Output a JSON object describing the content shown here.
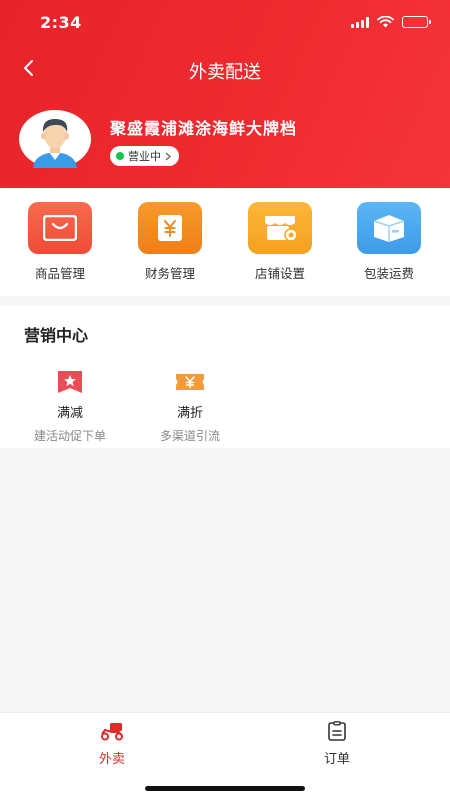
{
  "status_bar": {
    "time": "2:34"
  },
  "nav": {
    "title": "外卖配送",
    "back_icon": "chevron-left-icon"
  },
  "store": {
    "name": "聚盛霞浦滩涂海鲜大牌档",
    "status": "营业中"
  },
  "quick_actions": [
    {
      "label": "商品管理",
      "icon": "shopping-bag-icon",
      "color": "#f2563f"
    },
    {
      "label": "财务管理",
      "icon": "wallet-yen-icon",
      "color": "#f08a1c"
    },
    {
      "label": "店铺设置",
      "icon": "store-settings-icon",
      "color": "#f5a623"
    },
    {
      "label": "包装运费",
      "icon": "package-box-icon",
      "color": "#4aa6f0"
    }
  ],
  "marketing": {
    "title": "营销中心",
    "items": [
      {
        "name": "满减",
        "desc": "建活动促下单",
        "icon": "star-flag-icon"
      },
      {
        "name": "满折",
        "desc": "多渠道引流",
        "icon": "yen-coupon-icon"
      }
    ]
  },
  "tabbar": {
    "active_color": "#e12a2a",
    "items": [
      {
        "label": "外卖",
        "icon": "delivery-scooter-icon",
        "active": true
      },
      {
        "label": "订单",
        "icon": "clipboard-icon",
        "active": false
      }
    ]
  }
}
